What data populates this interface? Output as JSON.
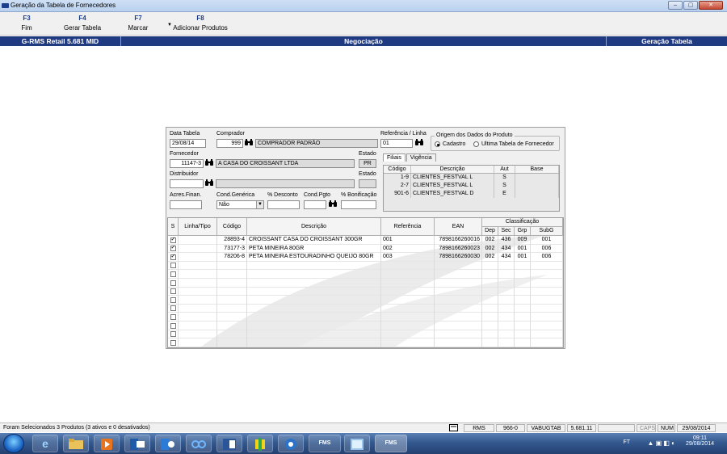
{
  "window": {
    "title": "Geração da Tabela de Fornecedores",
    "buttons": [
      "–",
      "▢",
      "✕"
    ]
  },
  "toolbar": [
    {
      "key": "F3",
      "label": "Fim"
    },
    {
      "key": "F4",
      "label": "Gerar Tabela"
    },
    {
      "key": "F7",
      "label": "Marcar"
    },
    {
      "key": "F8",
      "label": "Adicionar Produtos"
    }
  ],
  "status_band": {
    "left": "G-RMS Retail 5.681 MID",
    "center": "Negociação",
    "right": "Geração Tabela"
  },
  "form": {
    "data_tabela_label": "Data Tabela",
    "data_tabela": "29/08/14",
    "comprador_label": "Comprador",
    "comprador_code": "999",
    "comprador_name": "COMPRADOR PADRÃO",
    "referencia_label": "Referência / Linha",
    "referencia": "01",
    "fornecedor_label": "Fornecedor",
    "fornecedor_code": "11147-3",
    "fornecedor_name": "A CASA DO CROISSANT LTDA",
    "estado_label": "Estado",
    "estado": "PR",
    "distribuidor_label": "Distribuidor",
    "distribuidor_code": "",
    "distribuidor_name": "",
    "estado2_label": "Estado",
    "estado2": "",
    "acres_label": "Acres.Finan.",
    "acres": "",
    "cond_generica_label": "Cond.Genérica",
    "cond_generica": "Não",
    "desconto_label": "% Desconto",
    "desconto": "",
    "cond_pgto_label": "Cond.Pgto",
    "cond_pgto": "",
    "bonificacao_label": "% Bonificação",
    "bonificacao": ""
  },
  "origem": {
    "title": "Origem dos Dados do Produto",
    "options": [
      "Cadastro",
      "Ultima Tabela de Fornecedor"
    ],
    "selected": "Cadastro"
  },
  "tabs": [
    "Filiais",
    "Vigência"
  ],
  "filiais": {
    "headers": [
      "Código",
      "Descrição",
      "Aut",
      "Base"
    ],
    "rows": [
      {
        "codigo": "1-9",
        "descricao": "CLIENTES_FESTVAL L",
        "aut": "S",
        "base": ""
      },
      {
        "codigo": "2-7",
        "descricao": "CLIENTES_FESTVAL L",
        "aut": "S",
        "base": ""
      },
      {
        "codigo": "901-6",
        "descricao": "CLIENTES_FESTVAL D",
        "aut": "E",
        "base": ""
      }
    ]
  },
  "products": {
    "headers": {
      "s": "S",
      "linha": "Linha/Tipo",
      "codigo": "Código",
      "descricao": "Descrição",
      "referencia": "Referência",
      "ean": "EAN",
      "classificacao": "Classificação",
      "dep": "Dep",
      "sec": "Sec",
      "grp": "Grp",
      "subg": "SubG"
    },
    "rows": [
      {
        "checked": true,
        "linha": "",
        "codigo": "28893-4",
        "descricao": "CROISSANT CASA DO CROISSANT 300GR",
        "referencia": "001",
        "ean": "7898166260016",
        "dep": "002",
        "sec": "436",
        "grp": "009",
        "subg": "001"
      },
      {
        "checked": true,
        "linha": "",
        "codigo": "73177-3",
        "descricao": "PETA MINEIRA 80GR",
        "referencia": "002",
        "ean": "7898166260023",
        "dep": "002",
        "sec": "434",
        "grp": "001",
        "subg": "006"
      },
      {
        "checked": true,
        "linha": "",
        "codigo": "78206-8",
        "descricao": "PETA MINEIRA ESTOURADINHO QUEIJO 80GR",
        "referencia": "003",
        "ean": "7898166260030",
        "dep": "002",
        "sec": "434",
        "grp": "001",
        "subg": "006"
      }
    ],
    "empty_rows": 11
  },
  "status_bar": {
    "message": "Foram Selecionados 3 Produtos (3 ativos e 0 desativados)",
    "rms": "RMS",
    "code": "966-0",
    "user": "VABUGTAB",
    "version": "5.681.11",
    "caps": "CAPS",
    "num": "NUM",
    "date": "29/08/2014"
  },
  "taskbar": {
    "apps": [
      "e",
      "FMS",
      "FMS"
    ],
    "tray_lang": "FT",
    "time": "09:11",
    "date": "29/08/2014"
  }
}
